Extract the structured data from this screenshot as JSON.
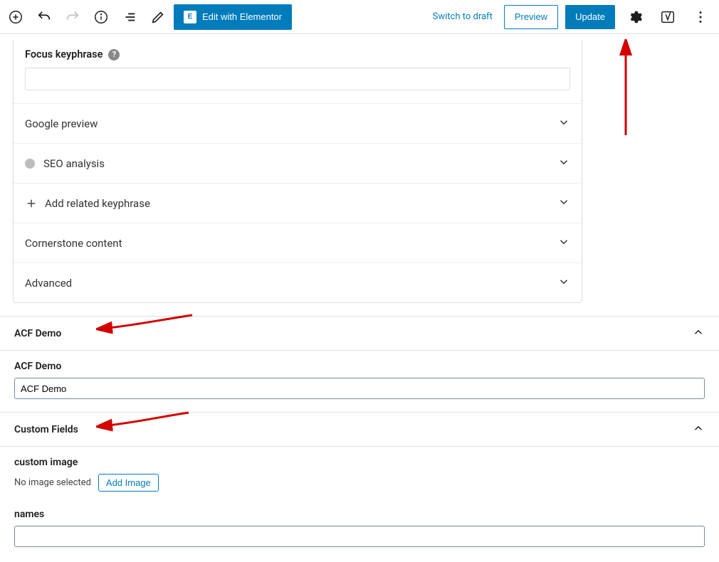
{
  "topbar": {
    "elementor_label": "Edit with Elementor",
    "switch_draft": "Switch to draft",
    "preview": "Preview",
    "update": "Update"
  },
  "seo": {
    "focus_label": "Focus keyphrase",
    "focus_value": "",
    "rows": {
      "google_preview": "Google preview",
      "seo_analysis": "SEO analysis",
      "add_related": "Add related keyphrase",
      "cornerstone": "Cornerstone content",
      "advanced": "Advanced"
    }
  },
  "acf_panel": {
    "title": "ACF Demo",
    "field_label": "ACF Demo",
    "field_value": "ACF Demo"
  },
  "custom_fields_panel": {
    "title": "Custom Fields",
    "image_label": "custom image",
    "no_image_text": "No image selected",
    "add_image_btn": "Add Image",
    "names_label": "names",
    "names_value": ""
  }
}
